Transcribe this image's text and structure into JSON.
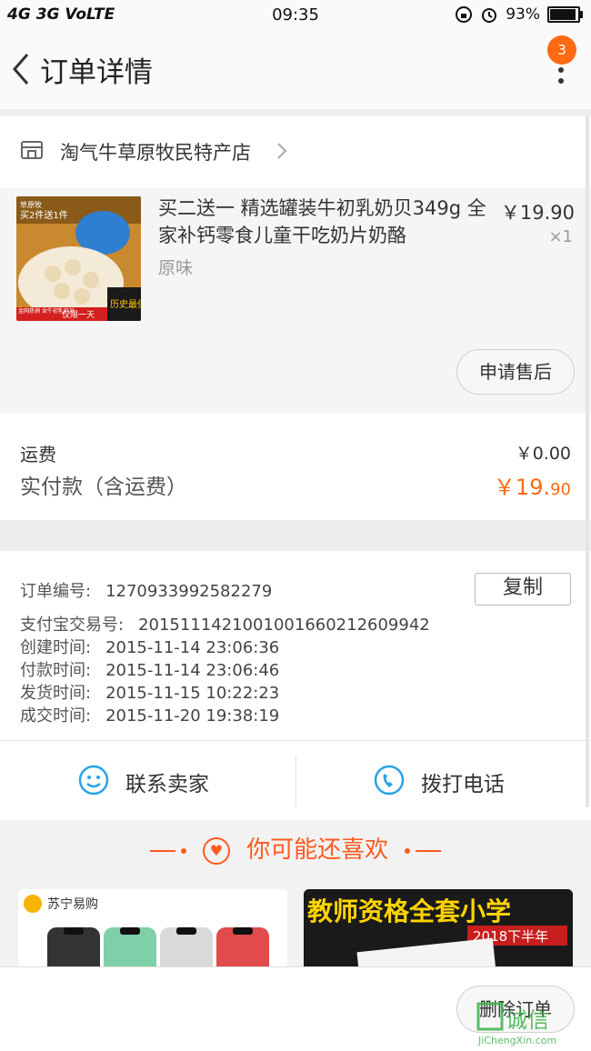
{
  "status_bar": {
    "network": "4G  3G  VoLTE",
    "time": "09:35",
    "battery": "93%",
    "battery_level": 0.93
  },
  "nav": {
    "title": "订单详情",
    "badge": "3"
  },
  "store": {
    "name": "淘气牛草原牧民特产店"
  },
  "product": {
    "title": "买二送一 精选罐装牛初乳奶贝349g 全家补钙零食儿童干吃奶片奶酪",
    "spec": "原味",
    "price": "￥19.90",
    "qty": "×1",
    "image_badge_top": "买2件送1件",
    "image_badge_bottom": "仅限一天",
    "image_badge_corner": "历史最低",
    "image_brand": "草原牧",
    "image_caption": "金网热销 含牛初乳奶贝",
    "after_sale_button": "申请售后"
  },
  "fees": {
    "shipping_label": "运费",
    "shipping_value": "￥0.00",
    "paid_label": "实付款（含运费）",
    "paid_value_main": "￥19.",
    "paid_value_decimal": "90"
  },
  "order_info": {
    "copy_button": "复制",
    "lines": [
      {
        "key": "订单编号:",
        "value": "1270933992582279"
      },
      {
        "key": "支付宝交易号:",
        "value": "2015111421001001660212609942"
      },
      {
        "key": "创建时间:",
        "value": "2015-11-14 23:06:36"
      },
      {
        "key": "付款时间:",
        "value": "2015-11-14 23:06:46"
      },
      {
        "key": "发货时间:",
        "value": "2015-11-15 10:22:23"
      },
      {
        "key": "成交时间:",
        "value": "2015-11-20 19:38:19"
      }
    ]
  },
  "contact": {
    "seller": "联系卖家",
    "phone": "拨打电话"
  },
  "recommend": {
    "title": "你可能还喜欢",
    "card1_brand": "苏宁易购",
    "card2_text": "教师资格全套小学",
    "card2_sub": "2018下半年"
  },
  "bottom": {
    "delete_button": "删除订单",
    "watermark_text": "诚信",
    "watermark_url": "JiChengXin.com"
  },
  "colors": {
    "accent": "#ff6a13",
    "contact_icon": "#29a3e6"
  }
}
